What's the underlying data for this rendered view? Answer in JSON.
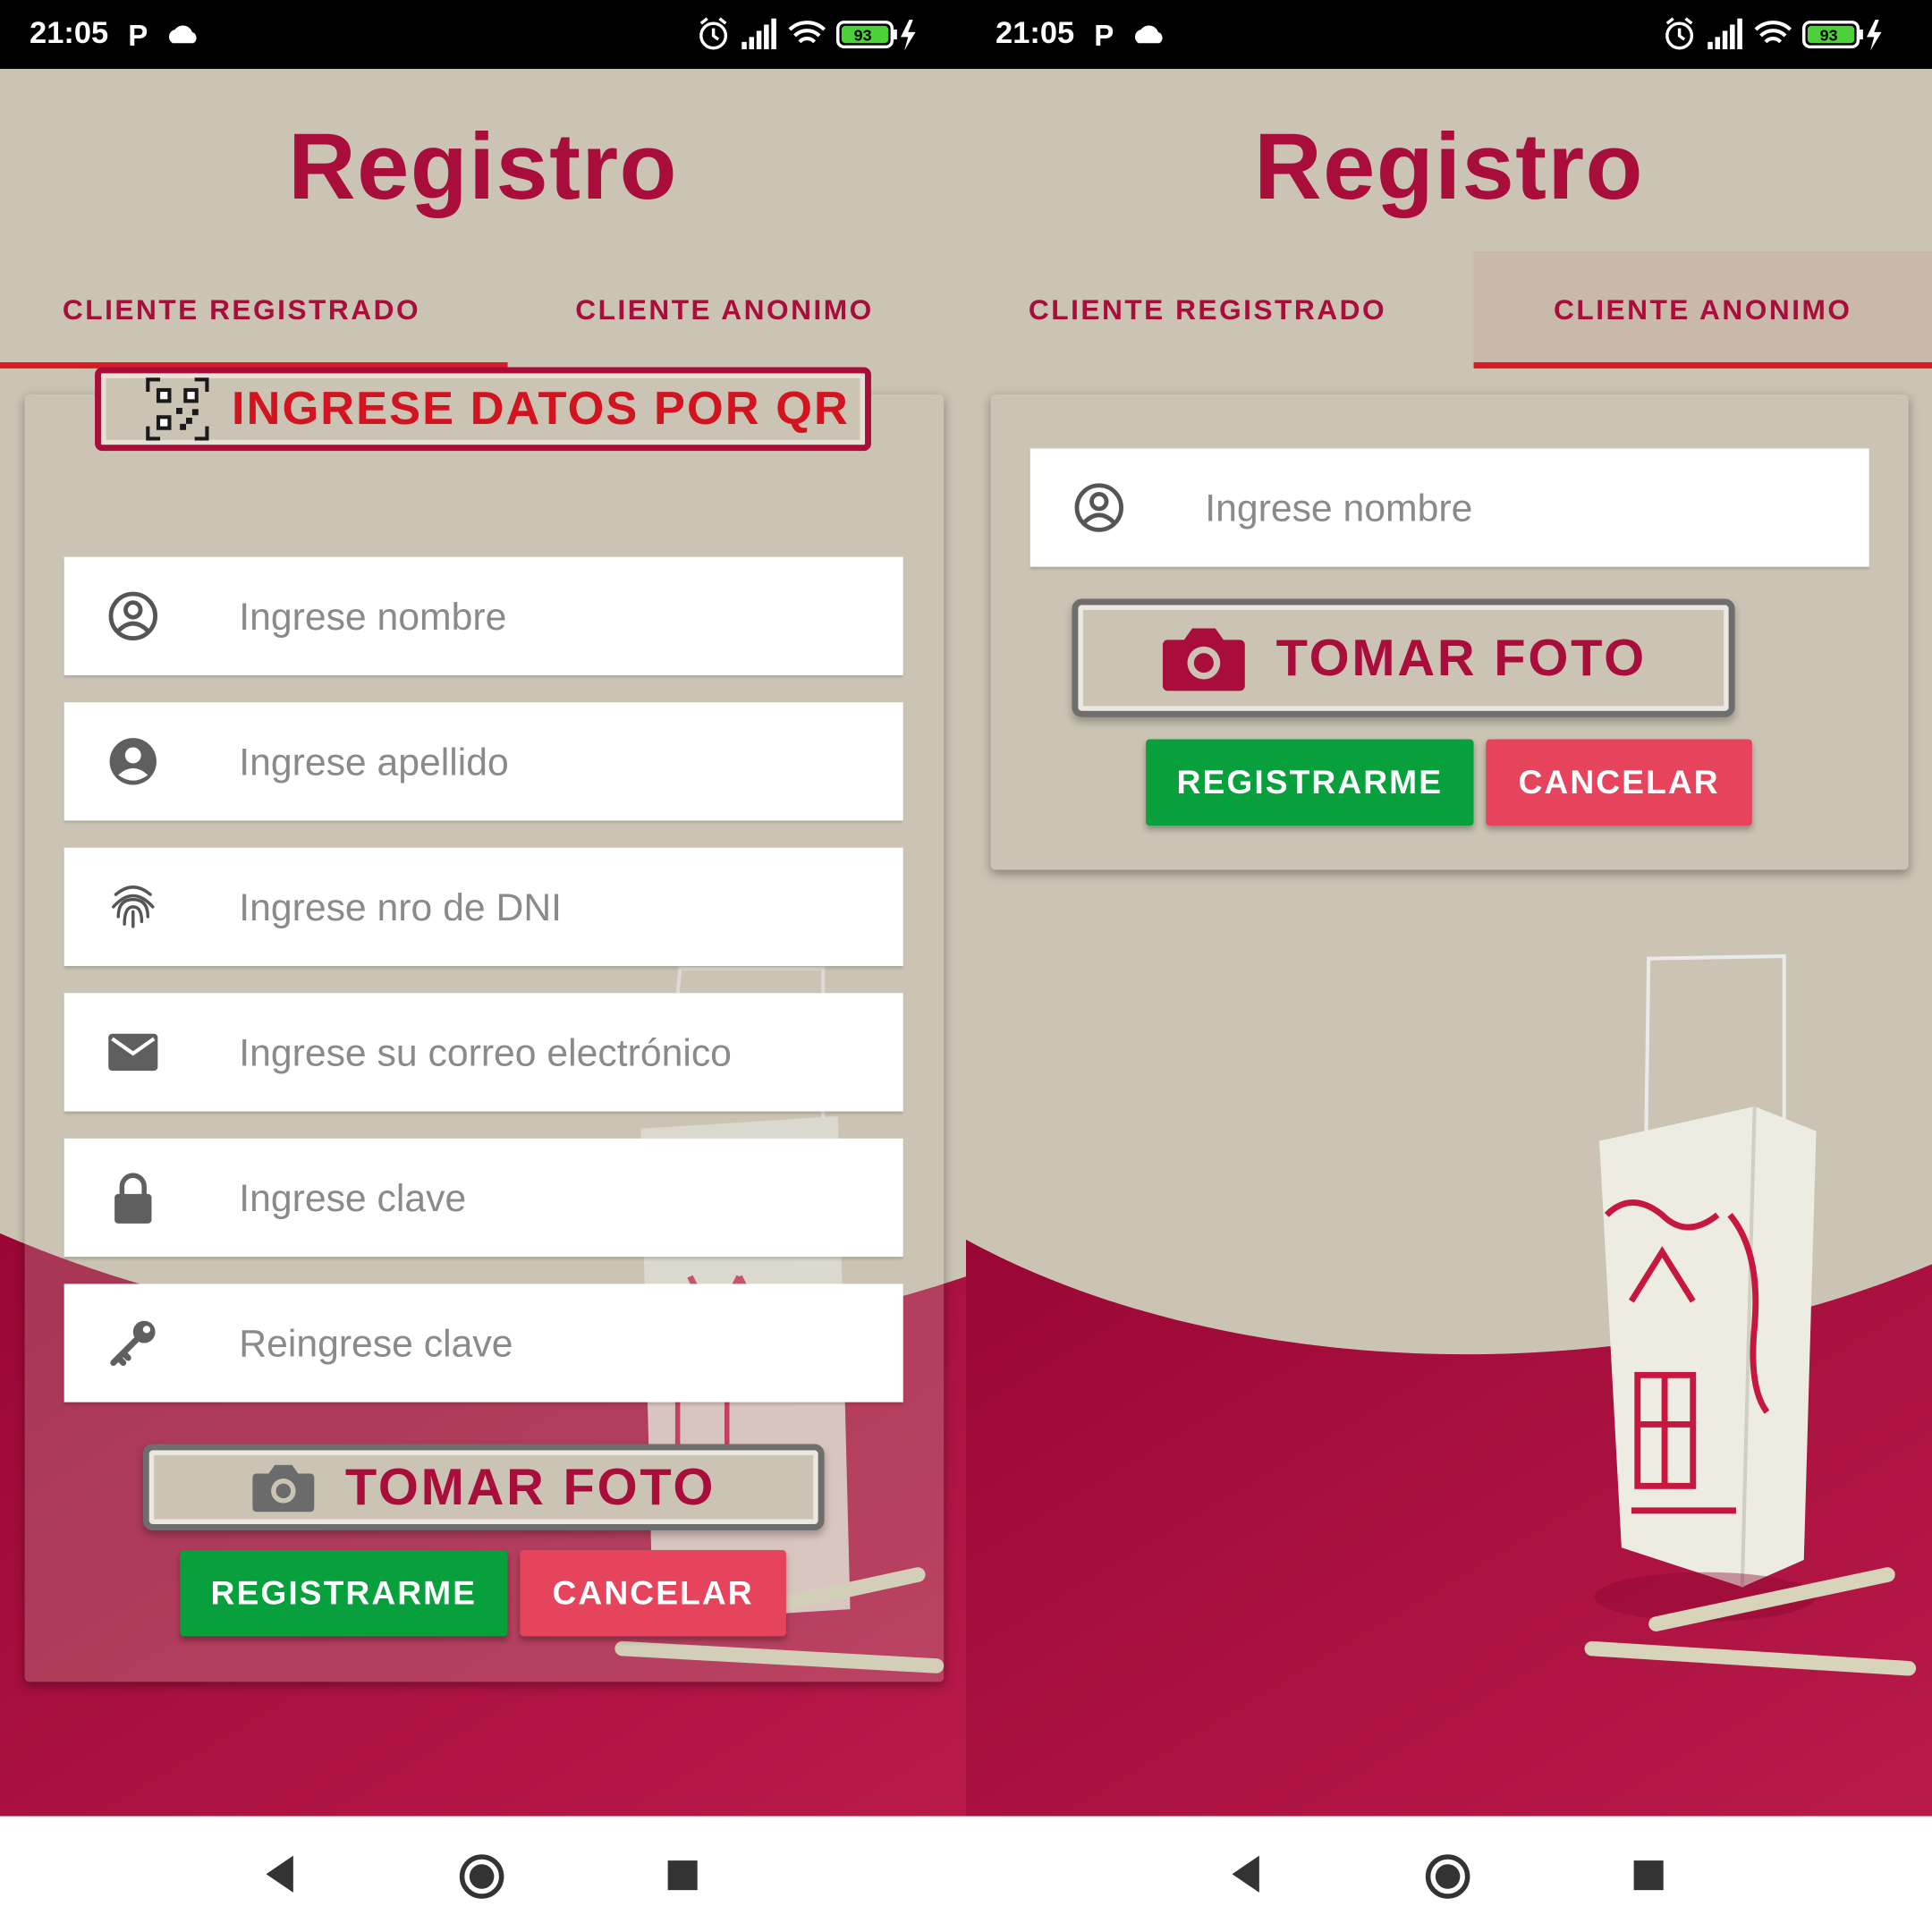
{
  "status_bar": {
    "time": "21:05",
    "battery": "93"
  },
  "screens": [
    {
      "title": "Registro",
      "tabs": [
        {
          "label": "CLIENTE REGISTRADO",
          "active": true
        },
        {
          "label": "CLIENTE ANONIMO",
          "active": false
        }
      ],
      "qr_button": {
        "label": "INGRESE DATOS POR QR",
        "icon": "qr-code-icon"
      },
      "fields": [
        {
          "icon": "account-circle-outline-icon",
          "placeholder": "Ingrese nombre"
        },
        {
          "icon": "account-circle-icon",
          "placeholder": "Ingrese apellido"
        },
        {
          "icon": "fingerprint-icon",
          "placeholder": "Ingrese nro de DNI"
        },
        {
          "icon": "email-icon",
          "placeholder": "Ingrese su correo electrónico"
        },
        {
          "icon": "lock-icon",
          "placeholder": "Ingrese clave"
        },
        {
          "icon": "key-icon",
          "placeholder": "Reingrese clave"
        }
      ],
      "photo_button": {
        "label": "TOMAR FOTO",
        "icon": "camera-icon"
      },
      "register_button": "REGISTRARME",
      "cancel_button": "CANCELAR"
    },
    {
      "title": "Registro",
      "tabs": [
        {
          "label": "CLIENTE REGISTRADO",
          "active": false
        },
        {
          "label": "CLIENTE ANONIMO",
          "active": true
        }
      ],
      "fields": [
        {
          "icon": "account-circle-outline-icon",
          "placeholder": "Ingrese nombre"
        }
      ],
      "photo_button": {
        "label": "TOMAR FOTO",
        "icon": "camera-icon"
      },
      "register_button": "REGISTRARME",
      "cancel_button": "CANCELAR"
    }
  ],
  "colors": {
    "brand": "#a80d3c",
    "accent_red": "#d21421",
    "background": "#cbc4b4",
    "register_green": "#07a03c",
    "cancel_red": "#e6445c"
  },
  "nav": {
    "back": "back-icon",
    "home": "home-icon",
    "recents": "recents-icon"
  }
}
